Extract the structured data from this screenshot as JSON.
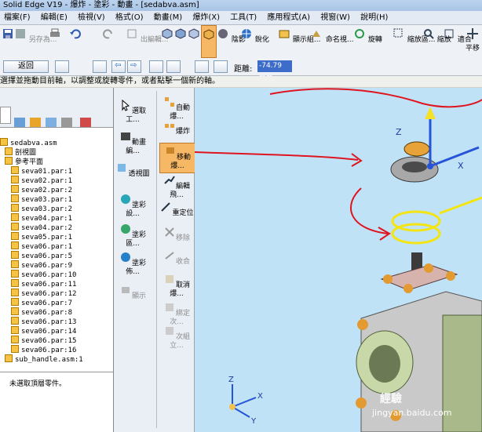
{
  "window": {
    "title": "Solid Edge V19 - 爆炸 - 塗彩 - 動畫 - [sedabva.asm]"
  },
  "menu": [
    "檔案(F)",
    "編輯(E)",
    "檢視(V)",
    "格式(O)",
    "動畫(M)",
    "爆炸(X)",
    "工具(T)",
    "應用程式(A)",
    "視窗(W)",
    "說明(H)"
  ],
  "toolbar": {
    "save_as": "另存為...",
    "exit_edit": "出編輯...",
    "shading": "陰影",
    "sharpen": "銳化",
    "show_group": "顯示組...",
    "name_group": "命名視...",
    "rotate": "旋轉",
    "zoom_area": "縮放區...",
    "zoom": "縮放",
    "fit": "適合",
    "pan": "平移"
  },
  "command_bar": {
    "back": "返回",
    "distance_label": "距離:",
    "distance_value": "-74.79 mm"
  },
  "prompt": "選擇並拖動目前軸，以調整或旋轉零件，或者點擊一個新的軸。",
  "tree": {
    "root": "sedabva.asm",
    "items": [
      "剖視圖",
      "參考平面",
      "seva01.par:1",
      "seva02.par:1",
      "seva02.par:2",
      "seva03.par:1",
      "seva03.par:2",
      "seva04.par:1",
      "seva04.par:2",
      "seva05.par:1",
      "seva06.par:1",
      "seva06.par:5",
      "seva06.par:9",
      "seva06.par:10",
      "seva06.par:11",
      "seva06.par:12",
      "seva06.par:7",
      "seva06.par:8",
      "seva06.par:13",
      "seva06.par:14",
      "seva06.par:15",
      "seva06.par:16",
      "sub_handle.asm:1"
    ],
    "status": "未選取頂層零件。"
  },
  "ribbon": {
    "select": "選取工...",
    "animation_edit": "動畫編...",
    "perspective": "透視圖",
    "color_settings": "塗彩設...",
    "color_zone": "塗彩區...",
    "color_make": "塗彩佈...",
    "display": "顯示",
    "auto_explode": "自動爆...",
    "explode": "爆炸",
    "move_explode": "移動爆...",
    "edit_flight": "編輯飛...",
    "reposition": "重定位",
    "remove": "移除",
    "collapse": "收合",
    "unexplode": "取消爆...",
    "bind_next": "綁定次...",
    "next_level": "次組立..."
  },
  "viewport": {
    "watermark": "jingyan.baidu.com",
    "watermark_brand": "經驗",
    "axis_labels": {
      "x": "X",
      "y": "Y",
      "z": "Z"
    }
  },
  "colors": {
    "annotation_red": "#e0141e",
    "highlight_orange": "#f7b866",
    "viewport_bg": "#bfe2f7"
  }
}
